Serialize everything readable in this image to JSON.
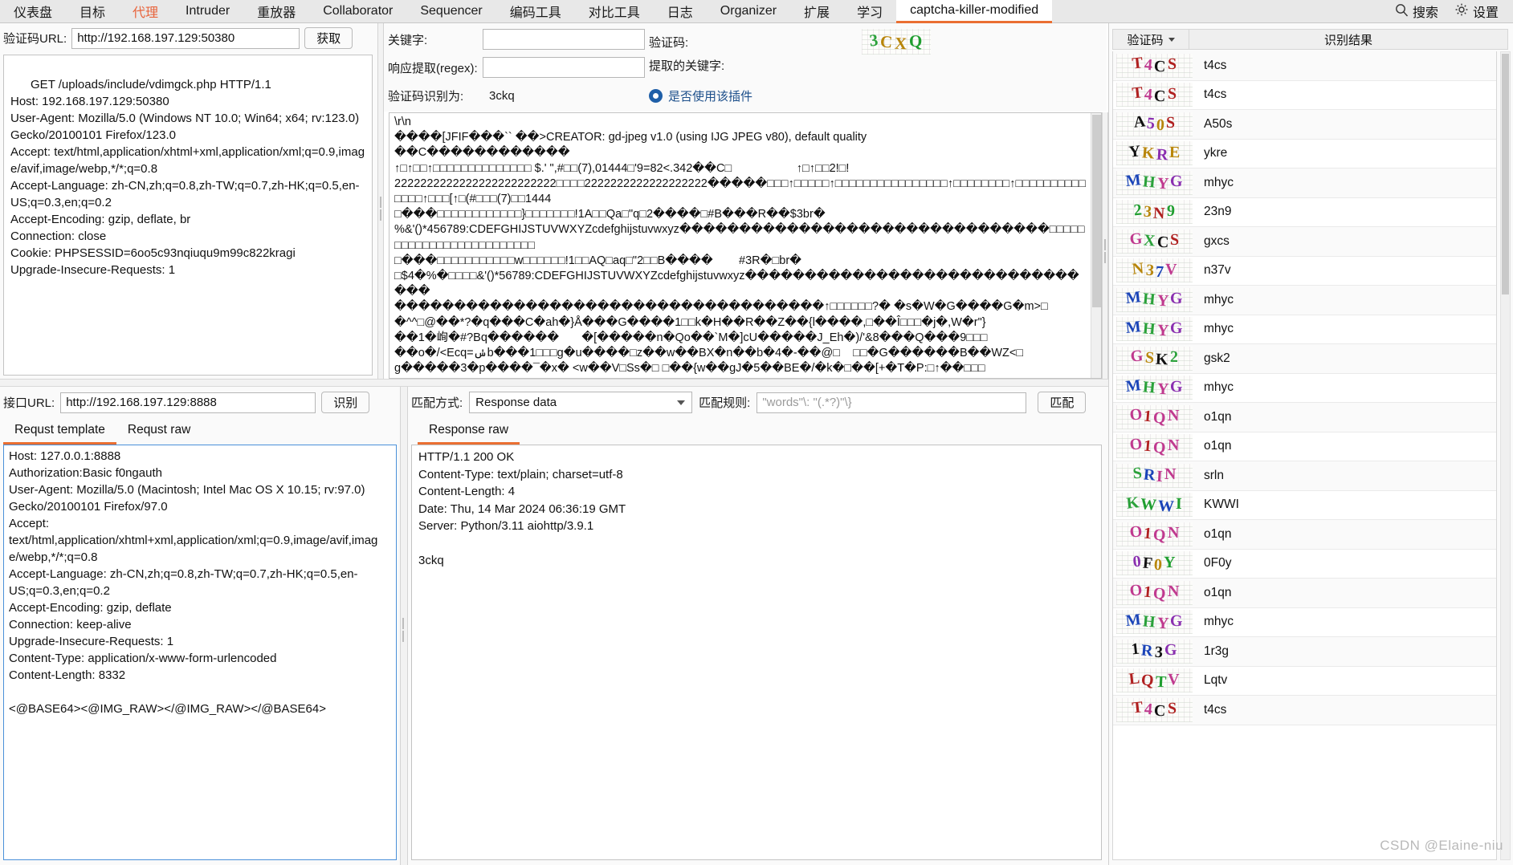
{
  "tabbar": {
    "tabs": [
      {
        "label": "仪表盘",
        "state": "normal"
      },
      {
        "label": "目标",
        "state": "normal"
      },
      {
        "label": "代理",
        "state": "accent"
      },
      {
        "label": "Intruder",
        "state": "normal"
      },
      {
        "label": "重放器",
        "state": "normal"
      },
      {
        "label": "Collaborator",
        "state": "normal"
      },
      {
        "label": "Sequencer",
        "state": "normal"
      },
      {
        "label": "编码工具",
        "state": "normal"
      },
      {
        "label": "对比工具",
        "state": "normal"
      },
      {
        "label": "日志",
        "state": "normal"
      },
      {
        "label": "Organizer",
        "state": "normal"
      },
      {
        "label": "扩展",
        "state": "normal"
      },
      {
        "label": "学习",
        "state": "normal"
      },
      {
        "label": "captcha-killer-modified",
        "state": "active"
      }
    ],
    "search_label": "搜索",
    "settings_label": "设置",
    "search_icon": "search-icon",
    "settings_icon": "gear-icon"
  },
  "left_top": {
    "url_label": "验证码URL:",
    "url_value": "http://192.168.197.129:50380",
    "url_placeholder": "",
    "fetch_button": "获取",
    "request_text": "GET /uploads/include/vdimgck.php HTTP/1.1\nHost: 192.168.197.129:50380\nUser-Agent: Mozilla/5.0 (Windows NT 10.0; Win64; x64; rv:123.0) Gecko/20100101 Firefox/123.0\nAccept: text/html,application/xhtml+xml,application/xml;q=0.9,image/avif,image/webp,*/*;q=0.8\nAccept-Language: zh-CN,zh;q=0.8,zh-TW;q=0.7,zh-HK;q=0.5,en-US;q=0.3,en;q=0.2\nAccept-Encoding: gzip, deflate, br\nConnection: close\nCookie: PHPSESSID=6oo5c93nqiuqu9m99c822kragi\nUpgrade-Insecure-Requests: 1"
  },
  "mid_top": {
    "keyword_label": "关键字:",
    "keyword_value": "",
    "regex_label": "响应提取(regex):",
    "regex_value": "",
    "recognized_label": "验证码识别为:",
    "recognized_value": "3ckq",
    "captcha_label": "验证码:",
    "extracted_kw_label": "提取的关键字:",
    "use_plugin_label": "是否使用该插件",
    "captcha_image_text": "3CXQ",
    "raw_dump": "\\r\\n\n����[JFIF���`` ��>CREATOR: gd-jpeg v1.0 (using IJG JPEG v80), default quality\n��C������������\n↑□↑□□↑□□□□□□□□□□□□□□ $.' \",#□□(7),01444□'9=82<.342��C□                    ↑□↑□□2!□!\n2222222222222222222222222□□□□2222222222222222222�����□□□↑□□□□□↑□□□□□□□□□□□□□□□□↑□□□□□□□□↑□□□□□□□□□□□□□□↑□□□[↑□(#□□□(7)□□1444\n□���□□□□□□□□□□□□}□□□□□□□!1A□□Qa□\"q□2����□#B���R��$3br�\n%&'()*456789:CDEFGHIJSTUVWXYZcdefghijstuvwxyz�������������������������������□□□□□□□□□□□□□□□□□□□□□□□□□\n□���□□□□□□□□□□□w□□□□□□!1□□AQ□aq□\"2□□B����        #3R�□br�\n□$4�%�□□□□&'()*56789:CDEFGHIJSTUVWXYZcdefghijstuvwxyz�������������������������������\n������������������������������������↑□□□□□□?� �s�W�G����G�m>□\n�^^□@��*?�q���C�ah�}Å���G����1□□k�H��R��Z��{l����,□��Î□□□�j�,W�r\"}\n��1�峋�#?Bq������       �[�����n�Qo��`M�]cU�����J_Eh�)/'&8���Q���9□□□\n��o�/<Ecq=ݭb���1□□□g�u����□z��w��BX�n��b�4�-��@□    □□�G������B��WZ<□\ng�����3�p����¯�x� <w��V□Ss�□ □��{w��gJ�5��BE�/�k�□��[+�T�P:□↑��□□□"
  },
  "left_bottom": {
    "iface_label": "接口URL:",
    "iface_value": "http://192.168.197.129:8888",
    "recognize_button": "识别",
    "tabs": [
      {
        "label": "Requst template",
        "active": true
      },
      {
        "label": "Requst raw",
        "active": false
      }
    ],
    "body_text": "Host: 127.0.0.1:8888\nAuthorization:Basic f0ngauth\nUser-Agent: Mozilla/5.0 (Macintosh; Intel Mac OS X 10.15; rv:97.0) Gecko/20100101 Firefox/97.0\nAccept: text/html,application/xhtml+xml,application/xml;q=0.9,image/avif,image/webp,*/*;q=0.8\nAccept-Language: zh-CN,zh;q=0.8,zh-TW;q=0.7,zh-HK;q=0.5,en-US;q=0.3,en;q=0.2\nAccept-Encoding: gzip, deflate\nConnection: keep-alive\nUpgrade-Insecure-Requests: 1\nContent-Type: application/x-www-form-urlencoded\nContent-Length: 8332\n\n<@BASE64><@IMG_RAW></@IMG_RAW></@BASE64>"
  },
  "mid_bottom": {
    "match_mode_label": "匹配方式:",
    "match_mode_value": "Response data",
    "match_rule_label": "匹配规则:",
    "match_rule_value": "",
    "match_rule_placeholder": "\"words\"\\: \"(.*?)\"\\}",
    "match_button": "匹配",
    "tabs": [
      {
        "label": "Response raw",
        "active": true
      }
    ],
    "body_text": "HTTP/1.1 200 OK\nContent-Type: text/plain; charset=utf-8\nContent-Length: 4\nDate: Thu, 14 Mar 2024 06:36:19 GMT\nServer: Python/3.11 aiohttp/3.9.1\n\n3ckq"
  },
  "right_panel": {
    "header": {
      "captcha_col": "验证码",
      "captcha_col_icon": "chevron-down-icon",
      "result_col": "识别结果"
    },
    "rows": [
      {
        "captcha": "T4CS",
        "result": "t4cs"
      },
      {
        "captcha": "T4CS",
        "result": "t4cs"
      },
      {
        "captcha": "A50S",
        "result": "A50s"
      },
      {
        "captcha": "YKRE",
        "result": "ykre"
      },
      {
        "captcha": "MHYG",
        "result": "mhyc"
      },
      {
        "captcha": "23N9",
        "result": "23n9"
      },
      {
        "captcha": "GXCS",
        "result": "gxcs"
      },
      {
        "captcha": "N37V",
        "result": "n37v"
      },
      {
        "captcha": "MHYG",
        "result": "mhyc"
      },
      {
        "captcha": "MHYG",
        "result": "mhyc"
      },
      {
        "captcha": "GSK2",
        "result": "gsk2"
      },
      {
        "captcha": "MHYG",
        "result": "mhyc"
      },
      {
        "captcha": "O1QN",
        "result": "o1qn"
      },
      {
        "captcha": "O1QN",
        "result": "o1qn"
      },
      {
        "captcha": "SRIN",
        "result": "srln"
      },
      {
        "captcha": "KWWI",
        "result": "KWWI"
      },
      {
        "captcha": "O1QN",
        "result": "o1qn"
      },
      {
        "captcha": "0F0Y",
        "result": "0F0y"
      },
      {
        "captcha": "O1QN",
        "result": "o1qn"
      },
      {
        "captcha": "MHYG",
        "result": "mhyc"
      },
      {
        "captcha": "1R3G",
        "result": "1r3g"
      },
      {
        "captcha": "LQTV",
        "result": "Lqtv"
      },
      {
        "captcha": "T4CS",
        "result": "t4cs"
      }
    ]
  },
  "watermark": "CSDN @Elaine-niu"
}
